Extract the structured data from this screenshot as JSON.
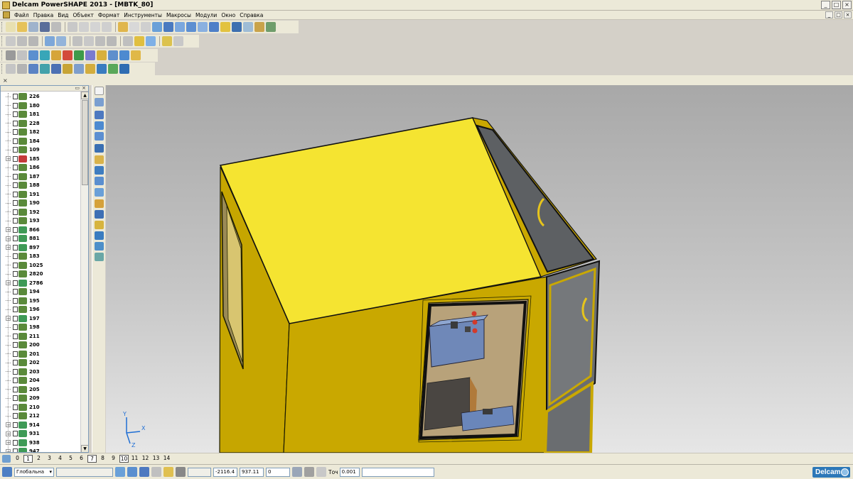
{
  "window": {
    "title": "Delcam PowerSHAPE 2013 - [MBTK_80]",
    "controls": {
      "minimize": "_",
      "maximize": "□",
      "close": "×"
    }
  },
  "menu": {
    "items": [
      "Файл",
      "Правка",
      "Вид",
      "Объект",
      "Формат",
      "Инструменты",
      "Макросы",
      "Модули",
      "Окно",
      "Справка"
    ]
  },
  "toolbar_close": "×",
  "tree": {
    "items": [
      {
        "label": "226",
        "expandable": false,
        "icon": "solid-icon"
      },
      {
        "label": "180",
        "expandable": false,
        "icon": "solid-icon"
      },
      {
        "label": "181",
        "expandable": false,
        "icon": "solid-icon"
      },
      {
        "label": "228",
        "expandable": false,
        "icon": "solid-icon"
      },
      {
        "label": "182",
        "expandable": false,
        "icon": "solid-icon"
      },
      {
        "label": "184",
        "expandable": false,
        "icon": "solid-icon"
      },
      {
        "label": "109",
        "expandable": false,
        "icon": "solid-icon"
      },
      {
        "label": "185",
        "expandable": true,
        "icon": "flagged-solid-icon"
      },
      {
        "label": "186",
        "expandable": false,
        "icon": "solid-icon"
      },
      {
        "label": "187",
        "expandable": false,
        "icon": "solid-icon"
      },
      {
        "label": "188",
        "expandable": false,
        "icon": "solid-icon"
      },
      {
        "label": "191",
        "expandable": false,
        "icon": "solid-icon"
      },
      {
        "label": "190",
        "expandable": false,
        "icon": "solid-icon"
      },
      {
        "label": "192",
        "expandable": false,
        "icon": "solid-icon"
      },
      {
        "label": "193",
        "expandable": false,
        "icon": "solid-icon"
      },
      {
        "label": "866",
        "expandable": true,
        "icon": "assembly-icon"
      },
      {
        "label": "881",
        "expandable": true,
        "icon": "assembly-icon"
      },
      {
        "label": "897",
        "expandable": true,
        "icon": "assembly-icon"
      },
      {
        "label": "183",
        "expandable": false,
        "icon": "solid-icon"
      },
      {
        "label": "1025",
        "expandable": false,
        "icon": "solid-icon"
      },
      {
        "label": "2820",
        "expandable": false,
        "icon": "solid-icon"
      },
      {
        "label": "2786",
        "expandable": true,
        "icon": "assembly-icon"
      },
      {
        "label": "194",
        "expandable": false,
        "icon": "solid-icon"
      },
      {
        "label": "195",
        "expandable": false,
        "icon": "solid-icon"
      },
      {
        "label": "196",
        "expandable": false,
        "icon": "solid-icon"
      },
      {
        "label": "197",
        "expandable": true,
        "icon": "assembly-icon"
      },
      {
        "label": "198",
        "expandable": false,
        "icon": "solid-icon"
      },
      {
        "label": "211",
        "expandable": false,
        "icon": "solid-icon"
      },
      {
        "label": "200",
        "expandable": false,
        "icon": "solid-icon"
      },
      {
        "label": "201",
        "expandable": false,
        "icon": "solid-icon"
      },
      {
        "label": "202",
        "expandable": false,
        "icon": "solid-icon"
      },
      {
        "label": "203",
        "expandable": false,
        "icon": "solid-icon"
      },
      {
        "label": "204",
        "expandable": false,
        "icon": "solid-icon"
      },
      {
        "label": "205",
        "expandable": false,
        "icon": "solid-icon"
      },
      {
        "label": "209",
        "expandable": false,
        "icon": "solid-icon"
      },
      {
        "label": "210",
        "expandable": false,
        "icon": "solid-icon"
      },
      {
        "label": "212",
        "expandable": false,
        "icon": "solid-icon"
      },
      {
        "label": "914",
        "expandable": true,
        "icon": "assembly-icon"
      },
      {
        "label": "931",
        "expandable": true,
        "icon": "assembly-icon"
      },
      {
        "label": "938",
        "expandable": true,
        "icon": "assembly-icon"
      },
      {
        "label": "947",
        "expandable": true,
        "icon": "assembly-icon"
      }
    ]
  },
  "viewport": {
    "axis_labels": {
      "x": "X",
      "y": "Y",
      "z": "Z"
    }
  },
  "layers": {
    "numbers": [
      "0",
      "1",
      "2",
      "3",
      "4",
      "5",
      "6",
      "7",
      "8",
      "9",
      "10",
      "11",
      "12",
      "13",
      "14"
    ],
    "boxed": [
      "1",
      "7",
      "10"
    ]
  },
  "status": {
    "workplane": "Глобальна",
    "x_value": "-2116.4",
    "y_value": "937.11",
    "z_value": "0",
    "tolerance_label": "Точ",
    "tolerance_value": "0.001",
    "logo_text": "Delcam"
  },
  "colors": {
    "body_yellow": "#c9a800",
    "roof_yellow": "#f5e431",
    "glass": "#6e7275",
    "viewport_top": "#a8a8a8",
    "viewport_bottom": "#e6e6e6",
    "chrome": "#ece9d8"
  }
}
